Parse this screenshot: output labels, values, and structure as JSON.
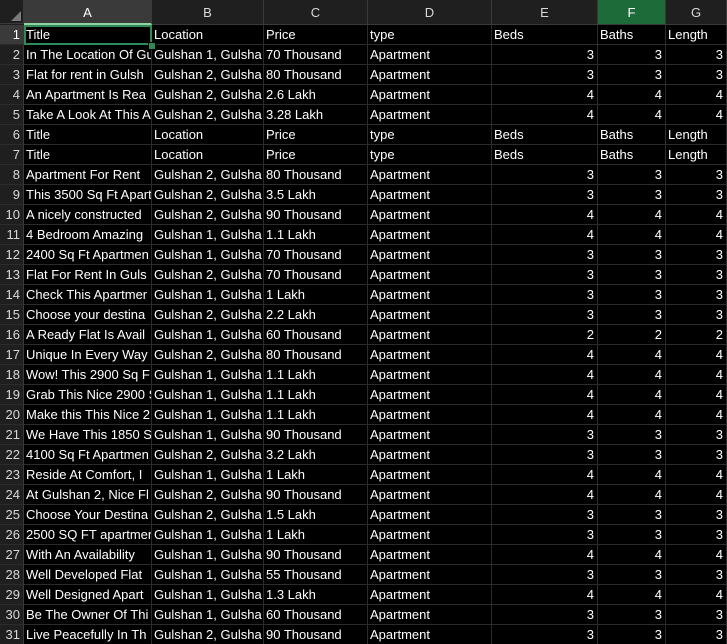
{
  "columns": [
    {
      "letter": "A",
      "selected": true
    },
    {
      "letter": "B"
    },
    {
      "letter": "C"
    },
    {
      "letter": "D"
    },
    {
      "letter": "E"
    },
    {
      "letter": "F",
      "active": true
    },
    {
      "letter": "G"
    }
  ],
  "rows": [
    {
      "n": "1",
      "cells": [
        "Title",
        "Location",
        "Price",
        "type",
        "Beds",
        "Baths",
        "Length"
      ],
      "header": true
    },
    {
      "n": "2",
      "cells": [
        "In The Location Of Gu",
        "Gulshan 1, Gulsha",
        "70 Thousand",
        "Apartment",
        "3",
        "3",
        "3"
      ]
    },
    {
      "n": "3",
      "cells": [
        "Flat for rent in Gulsh",
        "Gulshan 2, Gulsha",
        "80 Thousand",
        "Apartment",
        "3",
        "3",
        "3"
      ]
    },
    {
      "n": "4",
      "cells": [
        "An Apartment Is Rea",
        "Gulshan 2, Gulsha",
        "2.6 Lakh",
        "Apartment",
        "4",
        "4",
        "4"
      ]
    },
    {
      "n": "5",
      "cells": [
        "Take A Look At This A",
        "Gulshan 2, Gulsha",
        "3.28 Lakh",
        "Apartment",
        "4",
        "4",
        "4"
      ]
    },
    {
      "n": "6",
      "cells": [
        "Title",
        "Location",
        "Price",
        "type",
        "Beds",
        "Baths",
        "Length"
      ],
      "header": true
    },
    {
      "n": "7",
      "cells": [
        "Title",
        "Location",
        "Price",
        "type",
        "Beds",
        "Baths",
        "Length"
      ],
      "header": true
    },
    {
      "n": "8",
      "cells": [
        "Apartment For Rent",
        "Gulshan 2, Gulsha",
        "80 Thousand",
        "Apartment",
        "3",
        "3",
        "3"
      ]
    },
    {
      "n": "9",
      "cells": [
        "This 3500 Sq Ft Apart",
        "Gulshan 2, Gulsha",
        "3.5 Lakh",
        "Apartment",
        "3",
        "3",
        "3"
      ]
    },
    {
      "n": "10",
      "cells": [
        "A nicely constructed",
        "Gulshan 2, Gulsha",
        "90 Thousand",
        "Apartment",
        "4",
        "4",
        "4"
      ]
    },
    {
      "n": "11",
      "cells": [
        "4 Bedroom Amazing",
        "Gulshan 1, Gulsha",
        "1.1 Lakh",
        "Apartment",
        "4",
        "4",
        "4"
      ]
    },
    {
      "n": "12",
      "cells": [
        "2400 Sq Ft Apartmen",
        "Gulshan 1, Gulsha",
        "70 Thousand",
        "Apartment",
        "3",
        "3",
        "3"
      ]
    },
    {
      "n": "13",
      "cells": [
        "Flat For Rent In Guls",
        "Gulshan 2, Gulsha",
        "70 Thousand",
        "Apartment",
        "3",
        "3",
        "3"
      ]
    },
    {
      "n": "14",
      "cells": [
        "Check This Apartmer",
        "Gulshan 1, Gulsha",
        "1 Lakh",
        "Apartment",
        "3",
        "3",
        "3"
      ]
    },
    {
      "n": "15",
      "cells": [
        "Choose your destina",
        "Gulshan 2, Gulsha",
        "2.2 Lakh",
        "Apartment",
        "3",
        "3",
        "3"
      ]
    },
    {
      "n": "16",
      "cells": [
        "A Ready Flat Is Avail",
        "Gulshan 1, Gulsha",
        "60 Thousand",
        "Apartment",
        "2",
        "2",
        "2"
      ]
    },
    {
      "n": "17",
      "cells": [
        "Unique In Every Way",
        "Gulshan 2, Gulsha",
        "80 Thousand",
        "Apartment",
        "4",
        "4",
        "4"
      ]
    },
    {
      "n": "18",
      "cells": [
        "Wow! This 2900 Sq F",
        "Gulshan 1, Gulsha",
        "1.1 Lakh",
        "Apartment",
        "4",
        "4",
        "4"
      ]
    },
    {
      "n": "19",
      "cells": [
        "Grab This Nice 2900 S",
        "Gulshan 1, Gulsha",
        "1.1 Lakh",
        "Apartment",
        "4",
        "4",
        "4"
      ]
    },
    {
      "n": "20",
      "cells": [
        "Make this This Nice 2",
        "Gulshan 1, Gulsha",
        "1.1 Lakh",
        "Apartment",
        "4",
        "4",
        "4"
      ]
    },
    {
      "n": "21",
      "cells": [
        "We Have This 1850 S",
        "Gulshan 1, Gulsha",
        "90 Thousand",
        "Apartment",
        "3",
        "3",
        "3"
      ]
    },
    {
      "n": "22",
      "cells": [
        "4100 Sq Ft Apartmen",
        "Gulshan 2, Gulsha",
        "3.2 Lakh",
        "Apartment",
        "3",
        "3",
        "3"
      ]
    },
    {
      "n": "23",
      "cells": [
        "Reside At Comfort, I",
        "Gulshan 1, Gulsha",
        "1 Lakh",
        "Apartment",
        "4",
        "4",
        "4"
      ]
    },
    {
      "n": "24",
      "cells": [
        "At Gulshan 2, Nice Fl",
        "Gulshan 2, Gulsha",
        "90 Thousand",
        "Apartment",
        "4",
        "4",
        "4"
      ]
    },
    {
      "n": "25",
      "cells": [
        "Choose Your Destina",
        "Gulshan 2, Gulsha",
        "1.5 Lakh",
        "Apartment",
        "3",
        "3",
        "3"
      ]
    },
    {
      "n": "26",
      "cells": [
        "2500 SQ FT apartmer",
        "Gulshan 1, Gulsha",
        "1 Lakh",
        "Apartment",
        "3",
        "3",
        "3"
      ]
    },
    {
      "n": "27",
      "cells": [
        "With An Availability",
        "Gulshan 1, Gulsha",
        "90 Thousand",
        "Apartment",
        "4",
        "4",
        "4"
      ]
    },
    {
      "n": "28",
      "cells": [
        "Well Developed Flat",
        "Gulshan 1, Gulsha",
        "55 Thousand",
        "Apartment",
        "3",
        "3",
        "3"
      ]
    },
    {
      "n": "29",
      "cells": [
        "Well Designed Apart",
        "Gulshan 1, Gulsha",
        "1.3 Lakh",
        "Apartment",
        "4",
        "4",
        "4"
      ]
    },
    {
      "n": "30",
      "cells": [
        "Be The Owner Of Thi",
        "Gulshan 1, Gulsha",
        "60 Thousand",
        "Apartment",
        "3",
        "3",
        "3"
      ]
    },
    {
      "n": "31",
      "cells": [
        "Live Peacefully In Th",
        "Gulshan 2, Gulsha",
        "90 Thousand",
        "Apartment",
        "3",
        "3",
        "3"
      ]
    }
  ],
  "colors": {
    "active_cell_border": "#2e8b57",
    "active_column_header": "#1e6b3a",
    "grid_background": "#000000",
    "text": "#ffffff"
  }
}
